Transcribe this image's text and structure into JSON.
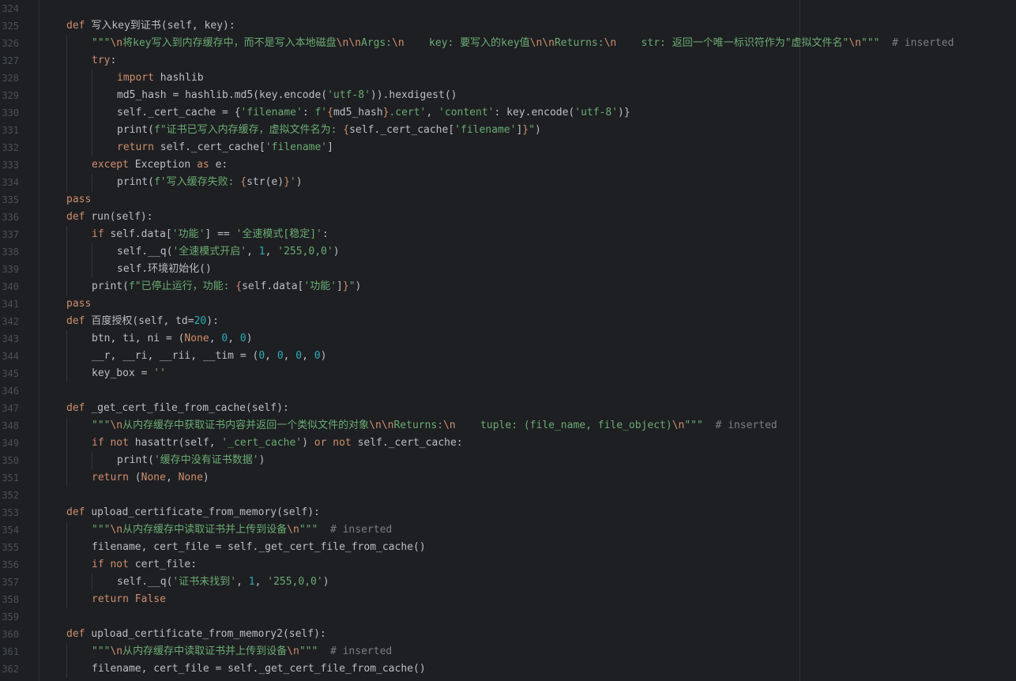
{
  "editor": {
    "language": "python",
    "colors": {
      "background": "#1e1f22",
      "keyword": "#cf8e6d",
      "string": "#6aab73",
      "number": "#2aacb8",
      "comment": "#7a7e85",
      "text": "#bcbec4",
      "line_number": "#4b5059"
    },
    "lines": [
      {
        "num": "324",
        "indent": 0,
        "tokens": []
      },
      {
        "num": "325",
        "indent": 1,
        "tokens": [
          {
            "t": "def ",
            "c": "kw"
          },
          {
            "t": "写入key到证书(self, key):",
            "c": "plain"
          }
        ]
      },
      {
        "num": "326",
        "indent": 2,
        "tokens": [
          {
            "t": "\"\"\"",
            "c": "str"
          },
          {
            "t": "\\n",
            "c": "esc"
          },
          {
            "t": "将key写入到内存缓存中，而不是写入本地磁盘",
            "c": "str"
          },
          {
            "t": "\\n\\n",
            "c": "esc"
          },
          {
            "t": "Args:",
            "c": "str"
          },
          {
            "t": "\\n",
            "c": "esc"
          },
          {
            "t": "    key: 要写入的key值",
            "c": "str"
          },
          {
            "t": "\\n\\n",
            "c": "esc"
          },
          {
            "t": "Returns:",
            "c": "str"
          },
          {
            "t": "\\n",
            "c": "esc"
          },
          {
            "t": "    str: 返回一个唯一标识符作为\"虚拟文件名\"",
            "c": "str"
          },
          {
            "t": "\\n",
            "c": "esc"
          },
          {
            "t": "\"\"\"",
            "c": "str"
          },
          {
            "t": "  # inserted",
            "c": "cmt"
          }
        ]
      },
      {
        "num": "327",
        "indent": 2,
        "tokens": [
          {
            "t": "try",
            "c": "kw"
          },
          {
            "t": ":",
            "c": "plain"
          }
        ]
      },
      {
        "num": "328",
        "indent": 3,
        "tokens": [
          {
            "t": "import ",
            "c": "kw"
          },
          {
            "t": "hashlib",
            "c": "plain"
          }
        ]
      },
      {
        "num": "329",
        "indent": 3,
        "tokens": [
          {
            "t": "md5_hash = hashlib.md5(key.encode(",
            "c": "plain"
          },
          {
            "t": "'utf-8'",
            "c": "str"
          },
          {
            "t": ")).hexdigest()",
            "c": "plain"
          }
        ]
      },
      {
        "num": "330",
        "indent": 3,
        "tokens": [
          {
            "t": "self._cert_cache = {",
            "c": "plain"
          },
          {
            "t": "'filename'",
            "c": "str"
          },
          {
            "t": ": ",
            "c": "plain"
          },
          {
            "t": "f'",
            "c": "str"
          },
          {
            "t": "{",
            "c": "esc"
          },
          {
            "t": "md5_hash",
            "c": "plain"
          },
          {
            "t": "}",
            "c": "esc"
          },
          {
            "t": ".cert'",
            "c": "str"
          },
          {
            "t": ", ",
            "c": "plain"
          },
          {
            "t": "'content'",
            "c": "str"
          },
          {
            "t": ": key.encode(",
            "c": "plain"
          },
          {
            "t": "'utf-8'",
            "c": "str"
          },
          {
            "t": ")}",
            "c": "plain"
          }
        ]
      },
      {
        "num": "331",
        "indent": 3,
        "tokens": [
          {
            "t": "print(",
            "c": "plain"
          },
          {
            "t": "f\"证书已写入内存缓存，虚拟文件名为: ",
            "c": "str"
          },
          {
            "t": "{",
            "c": "esc"
          },
          {
            "t": "self._cert_cache[",
            "c": "plain"
          },
          {
            "t": "'filename'",
            "c": "str"
          },
          {
            "t": "]",
            "c": "plain"
          },
          {
            "t": "}",
            "c": "esc"
          },
          {
            "t": "\"",
            "c": "str"
          },
          {
            "t": ")",
            "c": "plain"
          }
        ]
      },
      {
        "num": "332",
        "indent": 3,
        "tokens": [
          {
            "t": "return ",
            "c": "kw"
          },
          {
            "t": "self._cert_cache[",
            "c": "plain"
          },
          {
            "t": "'filename'",
            "c": "str"
          },
          {
            "t": "]",
            "c": "plain"
          }
        ]
      },
      {
        "num": "333",
        "indent": 2,
        "tokens": [
          {
            "t": "except ",
            "c": "kw"
          },
          {
            "t": "Exception ",
            "c": "plain"
          },
          {
            "t": "as ",
            "c": "kw"
          },
          {
            "t": "e:",
            "c": "plain"
          }
        ]
      },
      {
        "num": "334",
        "indent": 3,
        "tokens": [
          {
            "t": "print(",
            "c": "plain"
          },
          {
            "t": "f'写入缓存失败: ",
            "c": "str"
          },
          {
            "t": "{",
            "c": "esc"
          },
          {
            "t": "str(e)",
            "c": "plain"
          },
          {
            "t": "}",
            "c": "esc"
          },
          {
            "t": "'",
            "c": "str"
          },
          {
            "t": ")",
            "c": "plain"
          }
        ]
      },
      {
        "num": "335",
        "indent": 1,
        "tokens": [
          {
            "t": "pass",
            "c": "kw"
          }
        ]
      },
      {
        "num": "336",
        "indent": 1,
        "tokens": [
          {
            "t": "def ",
            "c": "kw"
          },
          {
            "t": "run(self):",
            "c": "plain"
          }
        ]
      },
      {
        "num": "337",
        "indent": 2,
        "tokens": [
          {
            "t": "if ",
            "c": "kw"
          },
          {
            "t": "self.data[",
            "c": "plain"
          },
          {
            "t": "'功能'",
            "c": "str"
          },
          {
            "t": "] == ",
            "c": "plain"
          },
          {
            "t": "'全速模式[稳定]'",
            "c": "str"
          },
          {
            "t": ":",
            "c": "plain"
          }
        ]
      },
      {
        "num": "338",
        "indent": 3,
        "tokens": [
          {
            "t": "self.__q(",
            "c": "plain"
          },
          {
            "t": "'全速模式开启'",
            "c": "str"
          },
          {
            "t": ", ",
            "c": "plain"
          },
          {
            "t": "1",
            "c": "num"
          },
          {
            "t": ", ",
            "c": "plain"
          },
          {
            "t": "'255,0,0'",
            "c": "str"
          },
          {
            "t": ")",
            "c": "plain"
          }
        ]
      },
      {
        "num": "339",
        "indent": 3,
        "tokens": [
          {
            "t": "self.环境初始化()",
            "c": "plain"
          }
        ]
      },
      {
        "num": "340",
        "indent": 2,
        "tokens": [
          {
            "t": "print(",
            "c": "plain"
          },
          {
            "t": "f\"已停止运行，功能: ",
            "c": "str"
          },
          {
            "t": "{",
            "c": "esc"
          },
          {
            "t": "self.data[",
            "c": "plain"
          },
          {
            "t": "'功能'",
            "c": "str"
          },
          {
            "t": "]",
            "c": "plain"
          },
          {
            "t": "}",
            "c": "esc"
          },
          {
            "t": "\"",
            "c": "str"
          },
          {
            "t": ")",
            "c": "plain"
          }
        ]
      },
      {
        "num": "341",
        "indent": 1,
        "tokens": [
          {
            "t": "pass",
            "c": "kw"
          }
        ]
      },
      {
        "num": "342",
        "indent": 1,
        "tokens": [
          {
            "t": "def ",
            "c": "kw"
          },
          {
            "t": "百度授权(self, td=",
            "c": "plain"
          },
          {
            "t": "20",
            "c": "num"
          },
          {
            "t": "):",
            "c": "plain"
          }
        ]
      },
      {
        "num": "343",
        "indent": 2,
        "tokens": [
          {
            "t": "btn, ti, ni = (",
            "c": "plain"
          },
          {
            "t": "None",
            "c": "kw"
          },
          {
            "t": ", ",
            "c": "plain"
          },
          {
            "t": "0",
            "c": "num"
          },
          {
            "t": ", ",
            "c": "plain"
          },
          {
            "t": "0",
            "c": "num"
          },
          {
            "t": ")",
            "c": "plain"
          }
        ]
      },
      {
        "num": "344",
        "indent": 2,
        "tokens": [
          {
            "t": "__r, __ri, __rii, __tim = (",
            "c": "plain"
          },
          {
            "t": "0",
            "c": "num"
          },
          {
            "t": ", ",
            "c": "plain"
          },
          {
            "t": "0",
            "c": "num"
          },
          {
            "t": ", ",
            "c": "plain"
          },
          {
            "t": "0",
            "c": "num"
          },
          {
            "t": ", ",
            "c": "plain"
          },
          {
            "t": "0",
            "c": "num"
          },
          {
            "t": ")",
            "c": "plain"
          }
        ]
      },
      {
        "num": "345",
        "indent": 2,
        "tokens": [
          {
            "t": "key_box = ",
            "c": "plain"
          },
          {
            "t": "''",
            "c": "str"
          }
        ]
      },
      {
        "num": "346",
        "indent": 0,
        "tokens": []
      },
      {
        "num": "347",
        "indent": 1,
        "tokens": [
          {
            "t": "def ",
            "c": "kw"
          },
          {
            "t": "_get_cert_file_from_cache(self):",
            "c": "plain"
          }
        ]
      },
      {
        "num": "348",
        "indent": 2,
        "tokens": [
          {
            "t": "\"\"\"",
            "c": "str"
          },
          {
            "t": "\\n",
            "c": "esc"
          },
          {
            "t": "从内存缓存中获取证书内容并返回一个类似文件的对象",
            "c": "str"
          },
          {
            "t": "\\n\\n",
            "c": "esc"
          },
          {
            "t": "Returns:",
            "c": "str"
          },
          {
            "t": "\\n",
            "c": "esc"
          },
          {
            "t": "    tuple: (file_name, file_object)",
            "c": "str"
          },
          {
            "t": "\\n",
            "c": "esc"
          },
          {
            "t": "\"\"\"",
            "c": "str"
          },
          {
            "t": "  # inserted",
            "c": "cmt"
          }
        ]
      },
      {
        "num": "349",
        "indent": 2,
        "tokens": [
          {
            "t": "if not ",
            "c": "kw"
          },
          {
            "t": "hasattr(self, ",
            "c": "plain"
          },
          {
            "t": "'_cert_cache'",
            "c": "str"
          },
          {
            "t": ") ",
            "c": "plain"
          },
          {
            "t": "or not ",
            "c": "kw"
          },
          {
            "t": "self._cert_cache:",
            "c": "plain"
          }
        ]
      },
      {
        "num": "350",
        "indent": 3,
        "tokens": [
          {
            "t": "print(",
            "c": "plain"
          },
          {
            "t": "'缓存中没有证书数据'",
            "c": "str"
          },
          {
            "t": ")",
            "c": "plain"
          }
        ]
      },
      {
        "num": "351",
        "indent": 2,
        "tokens": [
          {
            "t": "return ",
            "c": "kw"
          },
          {
            "t": "(",
            "c": "plain"
          },
          {
            "t": "None",
            "c": "kw"
          },
          {
            "t": ", ",
            "c": "plain"
          },
          {
            "t": "None",
            "c": "kw"
          },
          {
            "t": ")",
            "c": "plain"
          }
        ]
      },
      {
        "num": "352",
        "indent": 0,
        "tokens": []
      },
      {
        "num": "353",
        "indent": 1,
        "tokens": [
          {
            "t": "def ",
            "c": "kw"
          },
          {
            "t": "upload_certificate_from_memory(self):",
            "c": "plain"
          }
        ]
      },
      {
        "num": "354",
        "indent": 2,
        "tokens": [
          {
            "t": "\"\"\"",
            "c": "str"
          },
          {
            "t": "\\n",
            "c": "esc"
          },
          {
            "t": "从内存缓存中读取证书并上传到设备",
            "c": "str"
          },
          {
            "t": "\\n",
            "c": "esc"
          },
          {
            "t": "\"\"\"",
            "c": "str"
          },
          {
            "t": "  # inserted",
            "c": "cmt"
          }
        ]
      },
      {
        "num": "355",
        "indent": 2,
        "tokens": [
          {
            "t": "filename, cert_file = self._get_cert_file_from_cache()",
            "c": "plain"
          }
        ]
      },
      {
        "num": "356",
        "indent": 2,
        "tokens": [
          {
            "t": "if not ",
            "c": "kw"
          },
          {
            "t": "cert_file:",
            "c": "plain"
          }
        ]
      },
      {
        "num": "357",
        "indent": 3,
        "tokens": [
          {
            "t": "self.__q(",
            "c": "plain"
          },
          {
            "t": "'证书未找到'",
            "c": "str"
          },
          {
            "t": ", ",
            "c": "plain"
          },
          {
            "t": "1",
            "c": "num"
          },
          {
            "t": ", ",
            "c": "plain"
          },
          {
            "t": "'255,0,0'",
            "c": "str"
          },
          {
            "t": ")",
            "c": "plain"
          }
        ]
      },
      {
        "num": "358",
        "indent": 2,
        "tokens": [
          {
            "t": "return ",
            "c": "kw"
          },
          {
            "t": "False",
            "c": "kw"
          }
        ]
      },
      {
        "num": "359",
        "indent": 0,
        "tokens": []
      },
      {
        "num": "360",
        "indent": 1,
        "tokens": [
          {
            "t": "def ",
            "c": "kw"
          },
          {
            "t": "upload_certificate_from_memory2(self):",
            "c": "plain"
          }
        ]
      },
      {
        "num": "361",
        "indent": 2,
        "tokens": [
          {
            "t": "\"\"\"",
            "c": "str"
          },
          {
            "t": "\\n",
            "c": "esc"
          },
          {
            "t": "从内存缓存中读取证书并上传到设备",
            "c": "str"
          },
          {
            "t": "\\n",
            "c": "esc"
          },
          {
            "t": "\"\"\"",
            "c": "str"
          },
          {
            "t": "  # inserted",
            "c": "cmt"
          }
        ]
      },
      {
        "num": "362",
        "indent": 2,
        "tokens": [
          {
            "t": "filename, cert_file = self._get_cert_file_from_cache()",
            "c": "plain"
          }
        ]
      }
    ]
  }
}
